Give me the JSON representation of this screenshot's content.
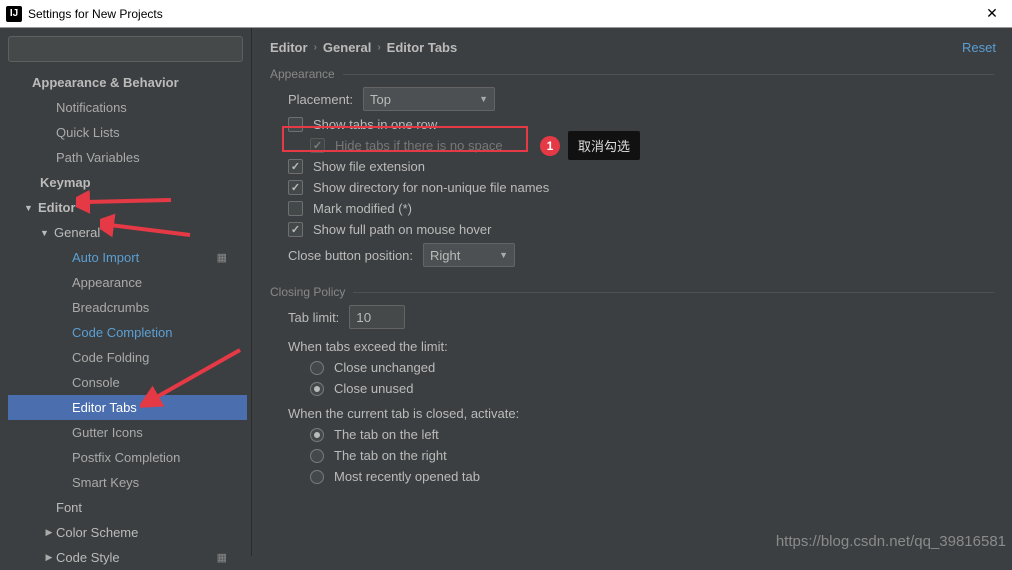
{
  "window": {
    "title": "Settings for New Projects"
  },
  "sidebar": {
    "categories": [
      {
        "label": "Appearance & Behavior",
        "expanded": false,
        "arrow": ""
      },
      {
        "label": "Notifications"
      },
      {
        "label": "Quick Lists"
      },
      {
        "label": "Path Variables"
      },
      {
        "label": "Keymap",
        "arrow": ""
      },
      {
        "label": "Editor",
        "arrow": "▼"
      },
      {
        "label": "General",
        "arrow": "▼"
      },
      {
        "label": "Auto Import"
      },
      {
        "label": "Appearance"
      },
      {
        "label": "Breadcrumbs"
      },
      {
        "label": "Code Completion"
      },
      {
        "label": "Code Folding"
      },
      {
        "label": "Console"
      },
      {
        "label": "Editor Tabs"
      },
      {
        "label": "Gutter Icons"
      },
      {
        "label": "Postfix Completion"
      },
      {
        "label": "Smart Keys"
      },
      {
        "label": "Font"
      },
      {
        "label": "Color Scheme",
        "arrow": "▶"
      },
      {
        "label": "Code Style",
        "arrow": "▶"
      }
    ]
  },
  "breadcrumb": {
    "a": "Editor",
    "b": "General",
    "c": "Editor Tabs"
  },
  "reset_label": "Reset",
  "sections": {
    "appearance": {
      "title": "Appearance",
      "placement_label": "Placement:",
      "placement_value": "Top",
      "show_one_row": "Show tabs in one row",
      "hide_no_space": "Hide tabs if there is no space",
      "show_ext": "Show file extension",
      "show_dir": "Show directory for non-unique file names",
      "mark_modified": "Mark modified (*)",
      "show_full_path": "Show full path on mouse hover",
      "close_pos_label": "Close button position:",
      "close_pos_value": "Right"
    },
    "closing": {
      "title": "Closing Policy",
      "tab_limit_label": "Tab limit:",
      "tab_limit_value": "10",
      "exceed_label": "When tabs exceed the limit:",
      "close_unchanged": "Close unchanged",
      "close_unused": "Close unused",
      "activate_label": "When the current tab is closed, activate:",
      "tab_left": "The tab on the left",
      "tab_right": "The tab on the right",
      "tab_recent": "Most recently opened tab"
    }
  },
  "annotations": {
    "badge": "1",
    "tooltip": "取消勾选",
    "watermark": "https://blog.csdn.net/qq_39816581"
  }
}
